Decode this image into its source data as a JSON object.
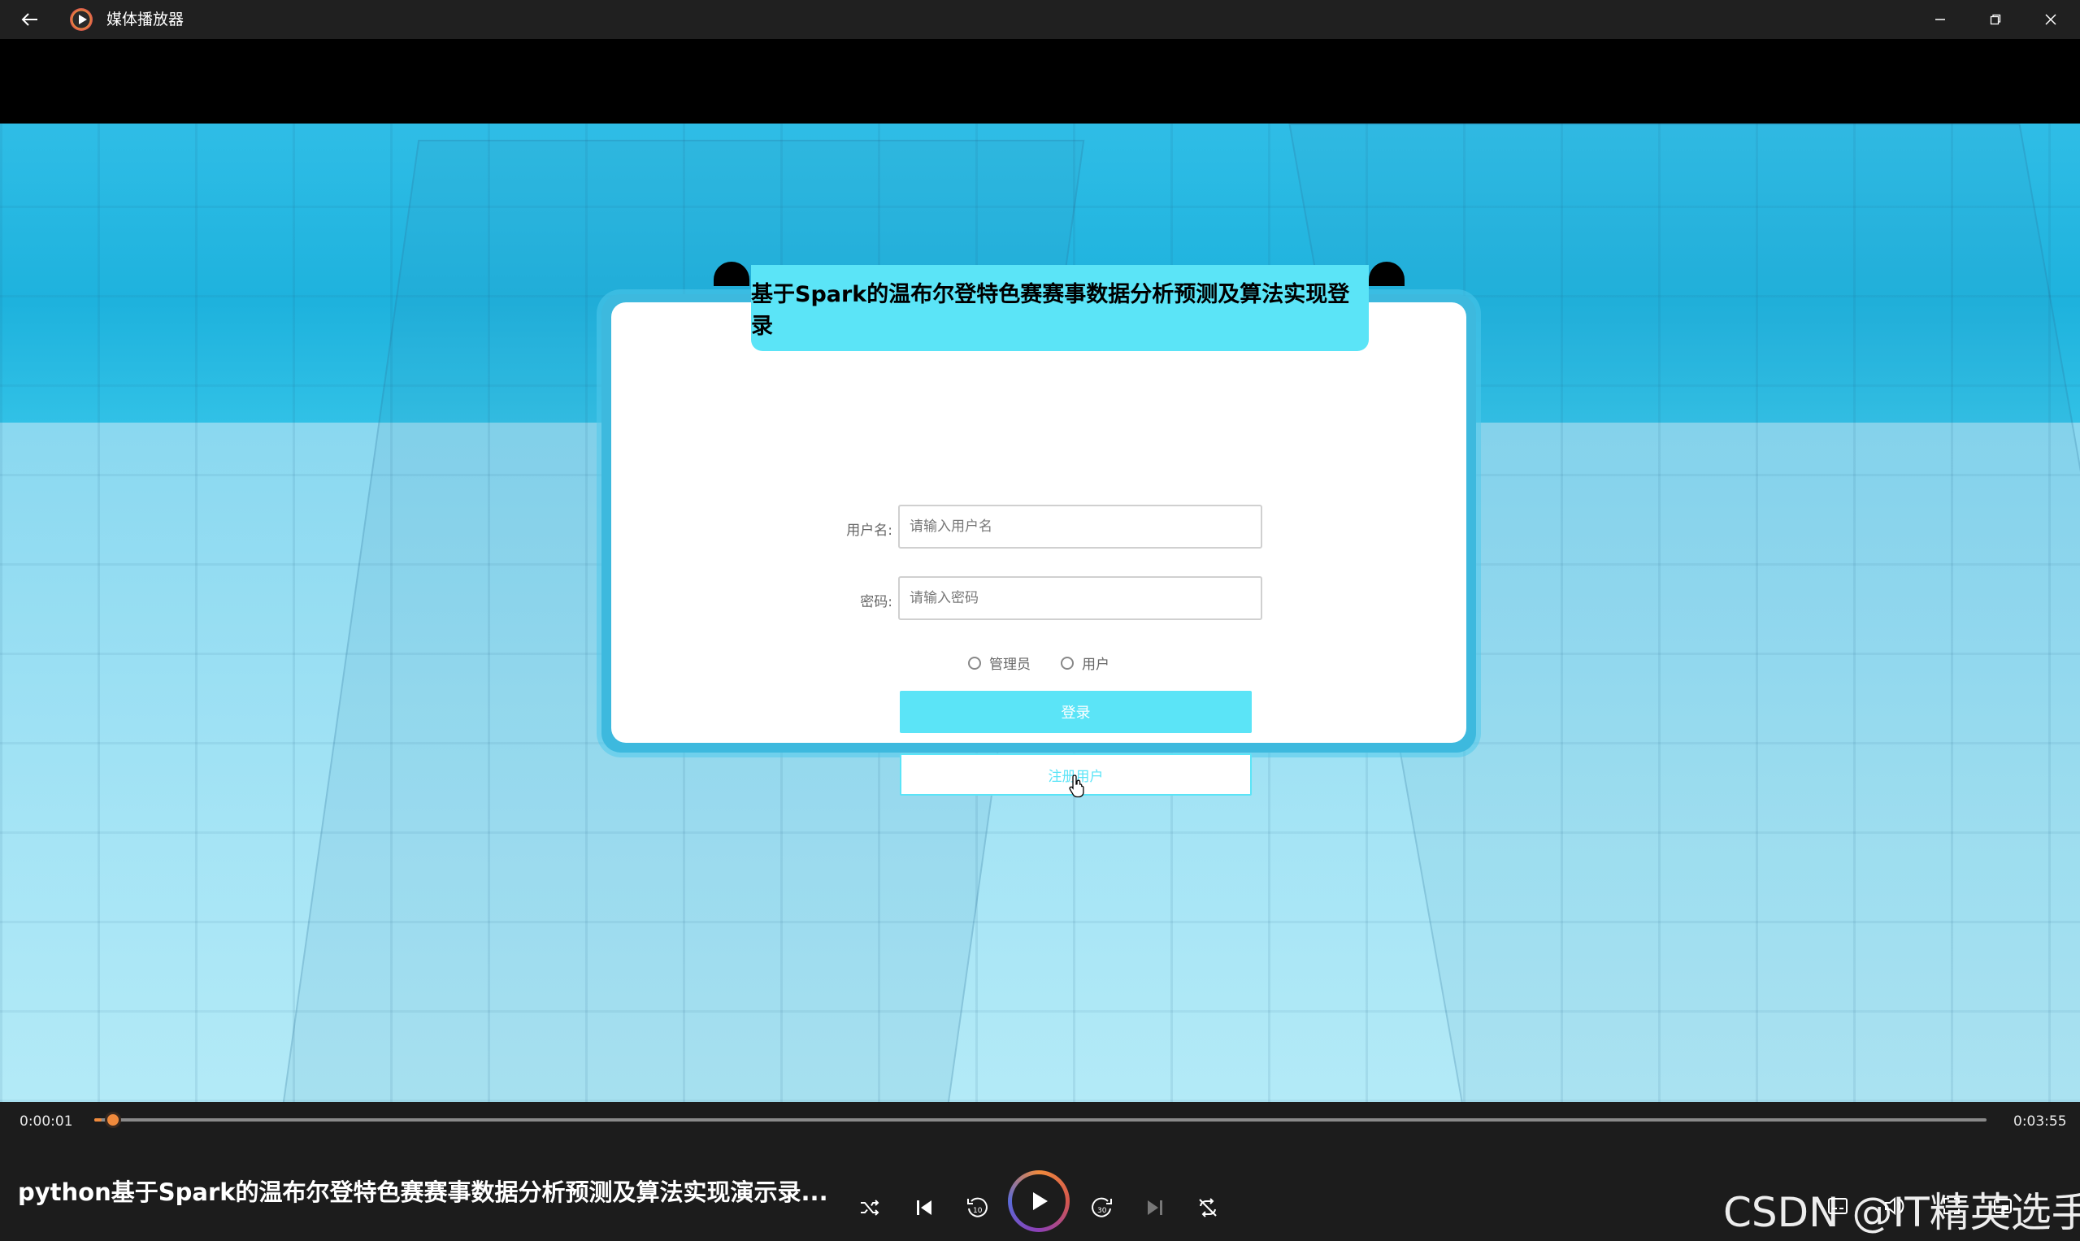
{
  "window": {
    "title": "媒体播放器"
  },
  "login": {
    "title": "基于Spark的温布尔登特色赛赛事数据分析预测及算法实现登录",
    "username_label": "用户名:",
    "username_placeholder": "请输入用户名",
    "password_label": "密码:",
    "password_placeholder": "请输入密码",
    "role_admin": "管理员",
    "role_user": "用户",
    "login_button": "登录",
    "register_button": "注册用户"
  },
  "player": {
    "current_time": "0:00:01",
    "total_time": "0:03:55",
    "progress": 0.004,
    "media_title": "python基于Spark的温布尔登特色赛赛事数据分析预测及算法实现演示录...",
    "watermark": "CSDN @IT精英选手",
    "accent_color": "#f08a3c"
  },
  "icons": {
    "back": "back-arrow-icon",
    "minimize": "minimize-icon",
    "maximize": "maximize-icon",
    "close": "close-icon",
    "shuffle": "shuffle-icon",
    "previous": "previous-track-icon",
    "rewind": "rewind-10-icon",
    "play": "play-icon",
    "forward": "forward-30-icon",
    "next": "next-track-icon",
    "repeat": "repeat-icon",
    "subtitles": "subtitles-icon",
    "volume": "volume-icon",
    "fullscreen": "fullscreen-icon",
    "mini": "mini-player-icon"
  }
}
